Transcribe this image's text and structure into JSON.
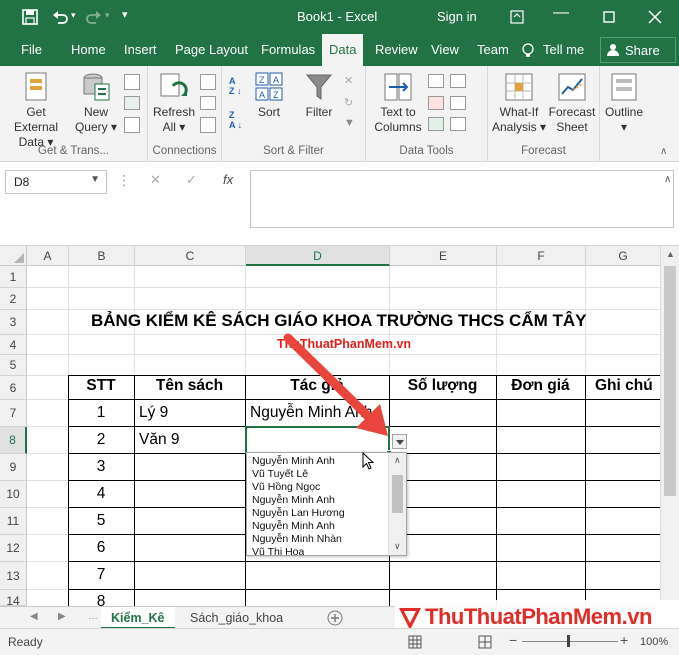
{
  "titlebar": {
    "title": "Book1  -  Excel",
    "signin": "Sign in"
  },
  "tabs": [
    "File",
    "Home",
    "Insert",
    "Page Layout",
    "Formulas",
    "Data",
    "Review",
    "View",
    "Team"
  ],
  "tellme": "Tell me",
  "share": "Share",
  "ribbon": {
    "get_external": [
      "Get External",
      "Data ▾"
    ],
    "new_query": [
      "New",
      "Query ▾"
    ],
    "refresh": [
      "Refresh",
      "All ▾"
    ],
    "sort": "Sort",
    "filter": "Filter",
    "text_to_columns": [
      "Text to",
      "Columns"
    ],
    "what_if": [
      "What-If",
      "Analysis ▾"
    ],
    "forecast_sheet": [
      "Forecast",
      "Sheet"
    ],
    "outline": [
      "Outline",
      "▾"
    ],
    "groups": {
      "get_transform": "Get & Trans...",
      "connections": "Connections",
      "sort_filter": "Sort & Filter",
      "data_tools": "Data Tools",
      "forecast": "Forecast"
    }
  },
  "formula_bar": {
    "name_box": "D8",
    "fx": "fx",
    "value": ""
  },
  "columns": [
    "A",
    "B",
    "C",
    "D",
    "E",
    "F",
    "G"
  ],
  "rows": [
    "1",
    "2",
    "3",
    "4",
    "5",
    "6",
    "7",
    "8",
    "9",
    "10",
    "11",
    "12",
    "13",
    "14"
  ],
  "sheet": {
    "title": "BẢNG KIỂM KÊ SÁCH GIÁO KHOA TRƯỜNG THCS CẨM TÂY",
    "watermark": "ThuThuatPhanMem.vn",
    "headers": [
      "STT",
      "Tên sách",
      "Tác giả",
      "Số lượng",
      "Đơn giá",
      "Ghi chú"
    ],
    "stt": [
      "1",
      "2",
      "3",
      "4",
      "5",
      "6",
      "7",
      "8"
    ],
    "books": [
      "Lý 9",
      "Văn 9"
    ],
    "author_d7": "Nguyễn Minh Anh"
  },
  "dropdown": [
    "Nguyễn Minh Anh",
    "Vũ Tuyết Lê",
    "Vũ Hồng Ngọc",
    "Nguyễn Minh Anh",
    "Nguyễn Lan Hương",
    "Nguyễn Minh Anh",
    "Nguyễn Minh Nhàn",
    "Vũ Thị Hoa"
  ],
  "sheets": [
    "Kiểm_Kê",
    "Sách_giáo_khoa"
  ],
  "status": {
    "ready": "Ready",
    "zoom": "100%"
  },
  "logo": "ThuThuatPhanMem.vn",
  "colors": {
    "excel_green": "#217346",
    "watermark_red": "#e0201b",
    "arrow_red": "#e8453c"
  }
}
